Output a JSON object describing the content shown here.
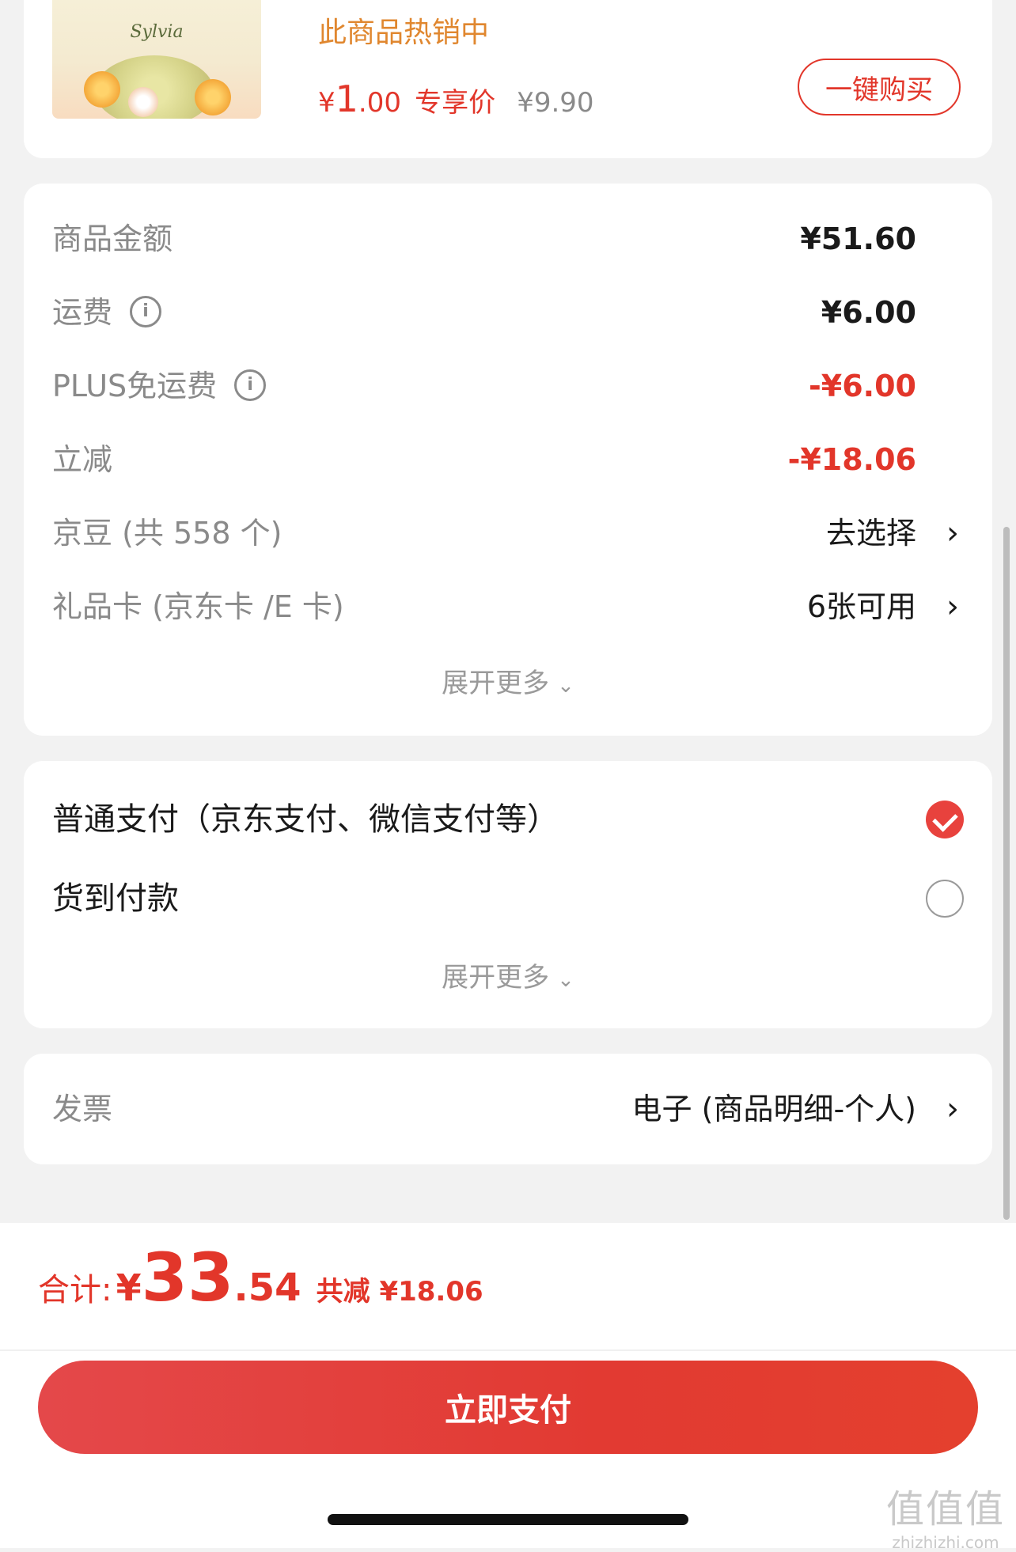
{
  "product": {
    "brand_text": "Sylvia",
    "hot_label": "此商品热销中",
    "price_currency": "¥",
    "price_int": "1",
    "price_dec": ".00",
    "price_tag": "专享价",
    "original_price": "¥9.90",
    "buy_button": "一键购买"
  },
  "fees": {
    "rows": [
      {
        "label": "商品金额",
        "value": "¥51.60"
      },
      {
        "label": "运费",
        "value": "¥6.00",
        "info_icon": "info-icon"
      },
      {
        "label": "PLUS免运费",
        "value": "-¥6.00",
        "info_icon": "info-icon"
      },
      {
        "label": "立减",
        "value": "-¥18.06"
      },
      {
        "label": "京豆 (共 558 个)",
        "value": "去选择"
      },
      {
        "label": "礼品卡 (京东卡 /E 卡)",
        "value": "6张可用"
      }
    ],
    "expand_label": "展开更多"
  },
  "payment": {
    "options": [
      {
        "label": "普通支付（京东支付、微信支付等）",
        "selected": true
      },
      {
        "label": "货到付款",
        "selected": false
      }
    ],
    "expand_label": "展开更多"
  },
  "invoice": {
    "label": "发票",
    "value": "电子 (商品明细-个人)"
  },
  "summary": {
    "total_label": "合计:",
    "total_currency": "¥",
    "total_int": "33",
    "total_dec": ".54",
    "discount_label": "共减 ¥18.06",
    "pay_button": "立即支付"
  },
  "watermark": {
    "logo": "值值值",
    "url": "zhizhizhi.com"
  },
  "colors": {
    "accent_red": "#e2362a",
    "hot_orange": "#e0872f",
    "muted_text": "#8a8a8a"
  }
}
